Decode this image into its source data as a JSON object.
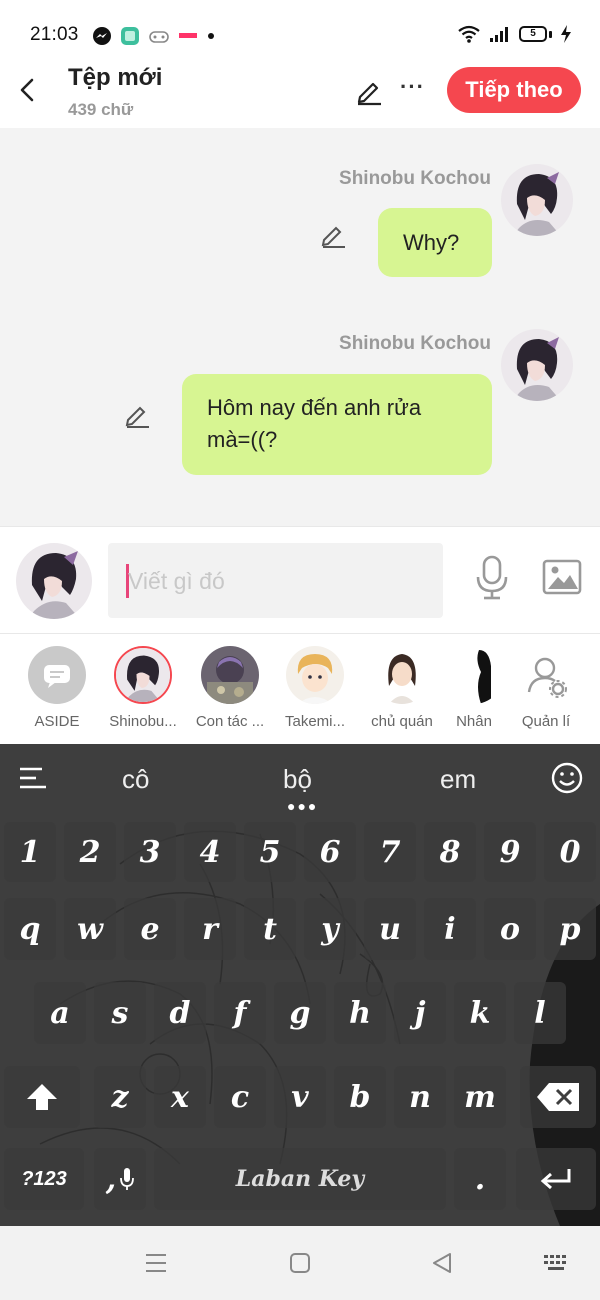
{
  "status_bar": {
    "time": "21:03",
    "battery": "5",
    "icons": [
      "messenger-icon",
      "app-icon",
      "game-icon",
      "notification-icon",
      "wifi-icon",
      "signal-icon",
      "battery-icon",
      "charging-icon"
    ]
  },
  "header": {
    "title": "Tệp mới",
    "subtitle": "439 chữ",
    "next_label": "Tiếp theo"
  },
  "messages": [
    {
      "sender": "Shinobu Kochou",
      "text": "Why?"
    },
    {
      "sender": "Shinobu Kochou",
      "text": "Hôm nay đến anh rửa mà=((?"
    }
  ],
  "composer": {
    "placeholder": "Viết gì đó"
  },
  "characters": [
    {
      "name": "ASIDE"
    },
    {
      "name": "Shinobu..."
    },
    {
      "name": "Con tác ..."
    },
    {
      "name": "Takemi..."
    },
    {
      "name": "chủ quán"
    },
    {
      "name": "Nhân"
    },
    {
      "name": "Quản lí"
    }
  ],
  "keyboard": {
    "suggestions": [
      "cô",
      "bộ",
      "em"
    ],
    "row_numbers": [
      "1",
      "2",
      "3",
      "4",
      "5",
      "6",
      "7",
      "8",
      "9",
      "0"
    ],
    "row_top": [
      "q",
      "w",
      "e",
      "r",
      "t",
      "y",
      "u",
      "i",
      "o",
      "p"
    ],
    "row_mid": [
      "a",
      "s",
      "d",
      "f",
      "g",
      "h",
      "j",
      "k",
      "l"
    ],
    "row_bot": [
      "z",
      "x",
      "c",
      "v",
      "b",
      "n",
      "m"
    ],
    "symbols_label": "?123",
    "comma_label": ",",
    "space_label": "Laban Key",
    "period_label": "."
  },
  "colors": {
    "accent": "#f5474f",
    "bubble": "#d7f592",
    "chat_bg": "#f3f3f3",
    "keyboard_bg": "#404040"
  }
}
